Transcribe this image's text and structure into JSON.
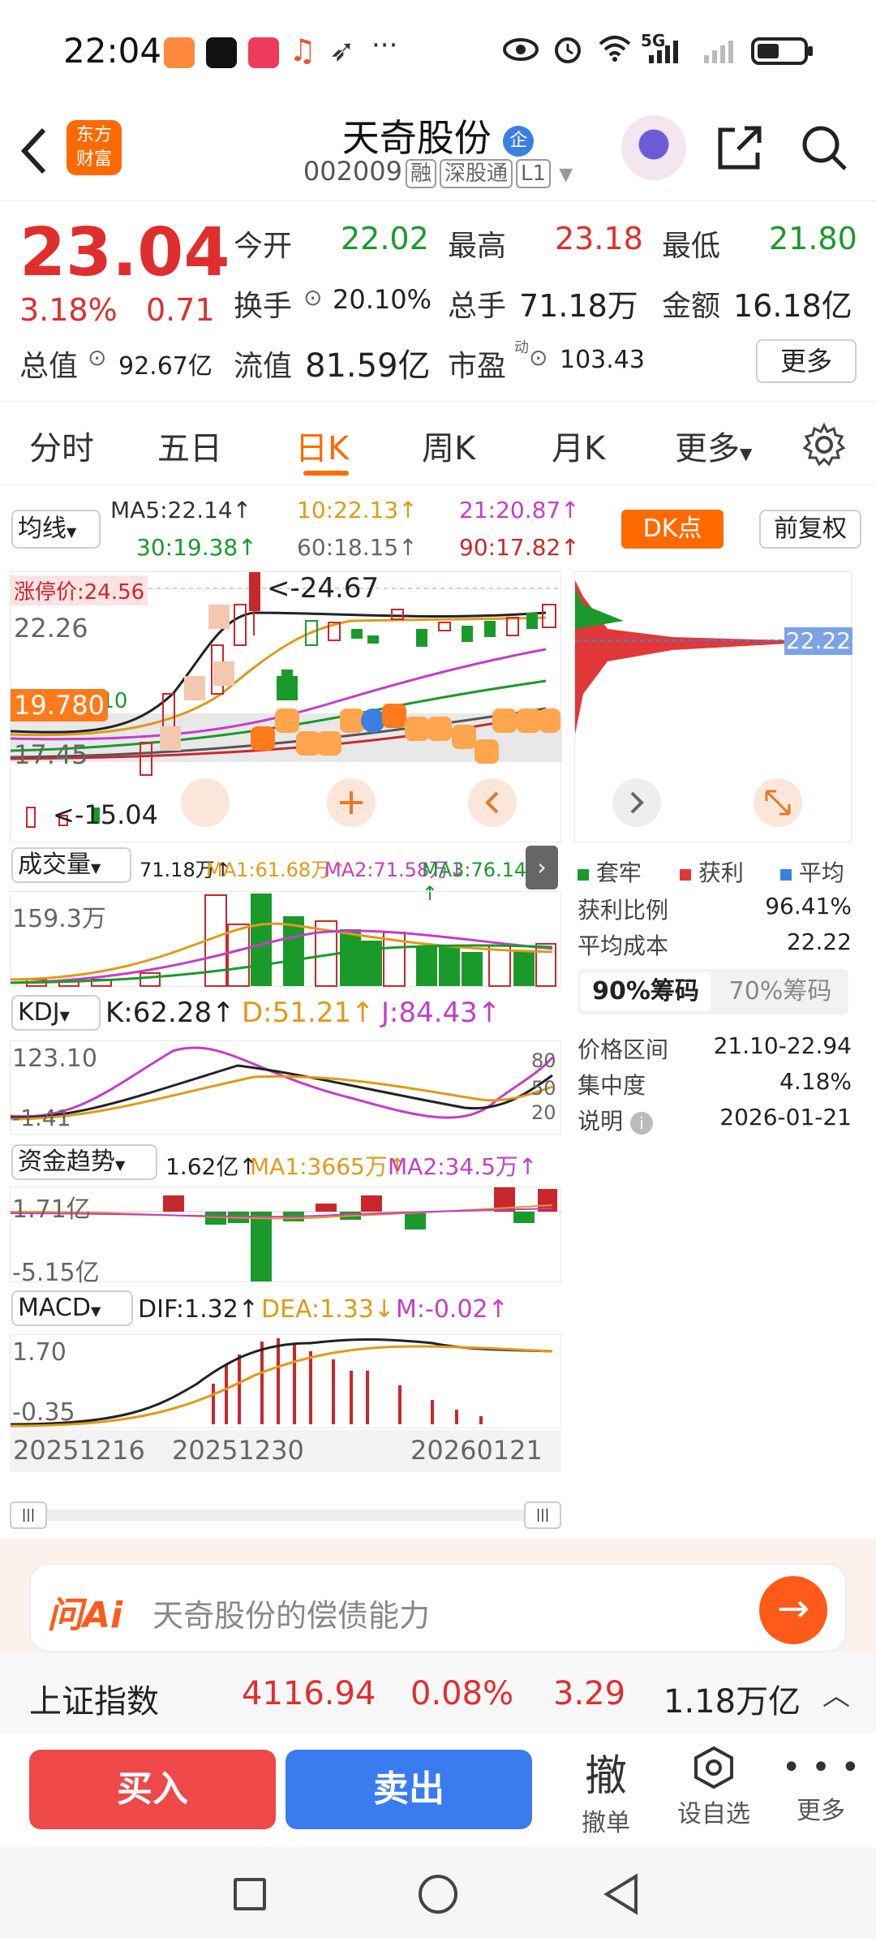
{
  "status_bar": {
    "time": "22:04",
    "more": "···",
    "network": "5G"
  },
  "header": {
    "logo_line1": "东方",
    "logo_line2": "财富",
    "stock_name": "天奇股份",
    "badge": "企",
    "stock_code": "002009",
    "tag_margin": "融",
    "tag_connect": "深股通",
    "tag_level": "L1"
  },
  "quote": {
    "price": "23.04",
    "change_pct": "3.18%",
    "change": "0.71",
    "open_label": "今开",
    "open": "22.02",
    "high_label": "最高",
    "high": "23.18",
    "low_label": "最低",
    "low": "21.80",
    "turnover_label": "换手",
    "turnover": "20.10%",
    "volume_label": "总手",
    "volume": "71.18万",
    "amount_label": "金额",
    "amount": "16.18亿",
    "mktcap_label": "总值",
    "mktcap": "92.67亿",
    "float_label": "流值",
    "float_cap": "81.59亿",
    "pe_label": "市盈",
    "pe_sup": "动",
    "pe": "103.43",
    "more_button": "更多"
  },
  "tabs": [
    "分时",
    "五日",
    "日K",
    "周K",
    "月K",
    "更多"
  ],
  "active_tab": 2,
  "ma_bar": {
    "selector": "均线",
    "ma5": "MA5:22.14↑",
    "ma10": "10:22.13↑",
    "ma21": "21:20.87↑",
    "ma30": "30:19.38↑",
    "ma60": "60:18.15↑",
    "ma90": "90:17.82↑",
    "dk_button": "DK点",
    "adjust_button": "前复权"
  },
  "kline": {
    "limit_up": "涨停价:24.56",
    "high_mark": "24.67",
    "y_top": "22.26",
    "y_mid": "17.45",
    "y_low": "15.04",
    "ref_left": "20.10",
    "price_tag": "19.780",
    "chip_price": "22.22"
  },
  "volume": {
    "selector": "成交量",
    "vol": "71.18万↑",
    "ma1": "MA1:61.68万↑",
    "ma2": "MA2:71.58万↓",
    "ma3": "MA3:76.14万↑",
    "y_top": "159.3万"
  },
  "kdj": {
    "selector": "KDJ",
    "k": "K:62.28↑",
    "d": "D:51.21↑",
    "j": "J:84.43↑",
    "y_top": "123.10",
    "y_low": "-1.41",
    "lv80": "80",
    "lv50": "50",
    "lv20": "20"
  },
  "fund": {
    "selector": "资金趋势",
    "val": "1.62亿↑",
    "ma1": "MA1:3665万↑",
    "ma2": "MA2:34.5万↑",
    "y_top": "1.71亿",
    "y_low": "-5.15亿"
  },
  "macd": {
    "selector": "MACD",
    "dif": "DIF:1.32↑",
    "dea": "DEA:1.33↓",
    "m": "M:-0.02↑",
    "y_top": "1.70",
    "y_low": "-0.35",
    "dates": [
      "20251216",
      "20251230",
      "20260121"
    ]
  },
  "chips": {
    "legend_locked": "套牢",
    "legend_profit": "获利",
    "legend_avg": "平均",
    "profit_ratio_label": "获利比例",
    "profit_ratio": "96.41%",
    "avg_cost_label": "平均成本",
    "avg_cost": "22.22",
    "tab90": "90%筹码",
    "tab70": "70%筹码",
    "range_label": "价格区间",
    "range": "21.10-22.94",
    "conc_label": "集中度",
    "conc": "4.18%",
    "note_label": "说明",
    "note": "2026-01-21"
  },
  "ai_bar": {
    "logo": "问Ai",
    "placeholder": "天奇股份的偿债能力"
  },
  "index_bar": {
    "name": "上证指数",
    "value": "4116.94",
    "pct": "0.08%",
    "change": "3.29",
    "amount": "1.18万亿"
  },
  "trade_bar": {
    "buy": "买入",
    "sell": "卖出",
    "cancel_icon_text": "撤",
    "cancel_label": "撤单",
    "watch_label": "设自选",
    "more_label": "更多"
  },
  "colors": {
    "up": "#e02e2e",
    "down": "#1a9a2b",
    "brand": "#ff6a00",
    "sell": "#3a7cf0"
  }
}
